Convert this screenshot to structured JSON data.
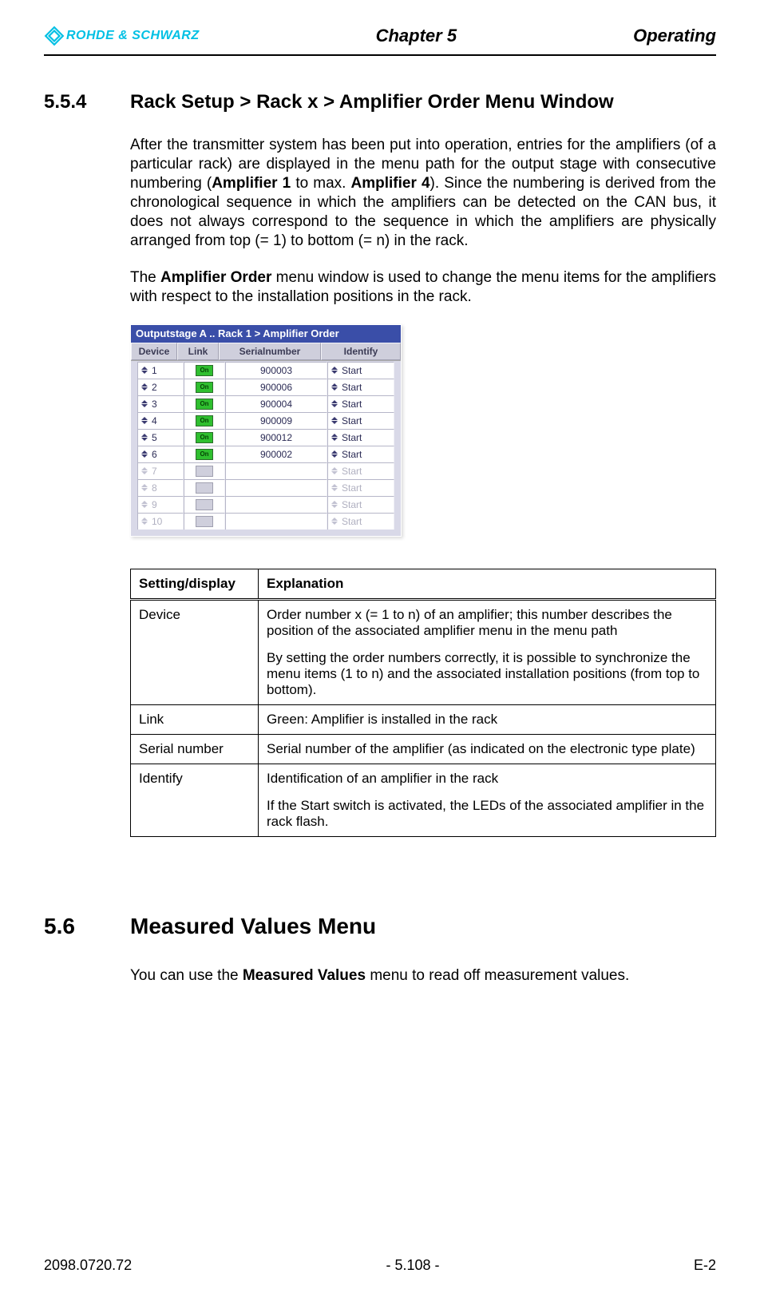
{
  "header": {
    "brand": "ROHDE & SCHWARZ",
    "center": "Chapter 5",
    "right": "Operating"
  },
  "section554": {
    "number": "5.5.4",
    "title": "Rack Setup > Rack x > Amplifier Order Menu Window",
    "para1_a": "After the transmitter system has been put into operation, entries for the amplifiers (of a particular rack) are displayed in the menu path for the output stage with consecutive numbering (",
    "para1_b": "Amplifier 1",
    "para1_c": " to max. ",
    "para1_d": "Amplifier 4",
    "para1_e": "). Since the numbering is derived from the chronological sequence in which the amplifiers can be detected on the CAN bus, it does not always correspond to the sequence in which the amplifiers are physically arranged from top (= 1) to bottom (= n) in the rack.",
    "para2_a": "The ",
    "para2_b": "Amplifier Order",
    "para2_c": " menu window is used to change the menu items for the amplifiers with respect to the installation positions in the rack."
  },
  "ampwin": {
    "title": "Outputstage A .. Rack 1 > Amplifier Order",
    "headers": {
      "device": "Device",
      "link": "Link",
      "serial": "Serialnumber",
      "identify": "Identify"
    },
    "linkLabel": "On",
    "rows": [
      {
        "dev": "1",
        "link": true,
        "serial": "900003",
        "ident": "Start",
        "enabled": true
      },
      {
        "dev": "2",
        "link": true,
        "serial": "900006",
        "ident": "Start",
        "enabled": true
      },
      {
        "dev": "3",
        "link": true,
        "serial": "900004",
        "ident": "Start",
        "enabled": true
      },
      {
        "dev": "4",
        "link": true,
        "serial": "900009",
        "ident": "Start",
        "enabled": true
      },
      {
        "dev": "5",
        "link": true,
        "serial": "900012",
        "ident": "Start",
        "enabled": true
      },
      {
        "dev": "6",
        "link": true,
        "serial": "900002",
        "ident": "Start",
        "enabled": true
      },
      {
        "dev": "7",
        "link": false,
        "serial": "",
        "ident": "Start",
        "enabled": false
      },
      {
        "dev": "8",
        "link": false,
        "serial": "",
        "ident": "Start",
        "enabled": false
      },
      {
        "dev": "9",
        "link": false,
        "serial": "",
        "ident": "Start",
        "enabled": false
      },
      {
        "dev": "10",
        "link": false,
        "serial": "",
        "ident": "Start",
        "enabled": false
      }
    ]
  },
  "exp": {
    "header_setting": "Setting/display",
    "header_expl": "Explanation",
    "rows": {
      "device": {
        "label": "Device",
        "p1": "Order number x (= 1 to n) of an amplifier; this number describes the position of the associated amplifier menu in the menu path",
        "p2": "By setting the order numbers correctly, it is possible to synchronize the menu items (1 to n) and the associated installation positions (from top to bottom)."
      },
      "link": {
        "label": "Link",
        "p1": "Green: Amplifier is installed in the rack"
      },
      "serial": {
        "label": "Serial number",
        "p1": "Serial number of the amplifier (as indicated on the electronic type plate)"
      },
      "identify": {
        "label": "Identify",
        "p1": "Identification of an amplifier in the rack",
        "p2": "If the Start switch is activated, the LEDs of the associated amplifier in the rack flash."
      }
    }
  },
  "section56": {
    "number": "5.6",
    "title": "Measured Values Menu",
    "para_a": "You can use the ",
    "para_b": "Measured Values",
    "para_c": " menu to read off measurement values."
  },
  "footer": {
    "left": "2098.0720.72",
    "center": "- 5.108 -",
    "right": "E-2"
  }
}
